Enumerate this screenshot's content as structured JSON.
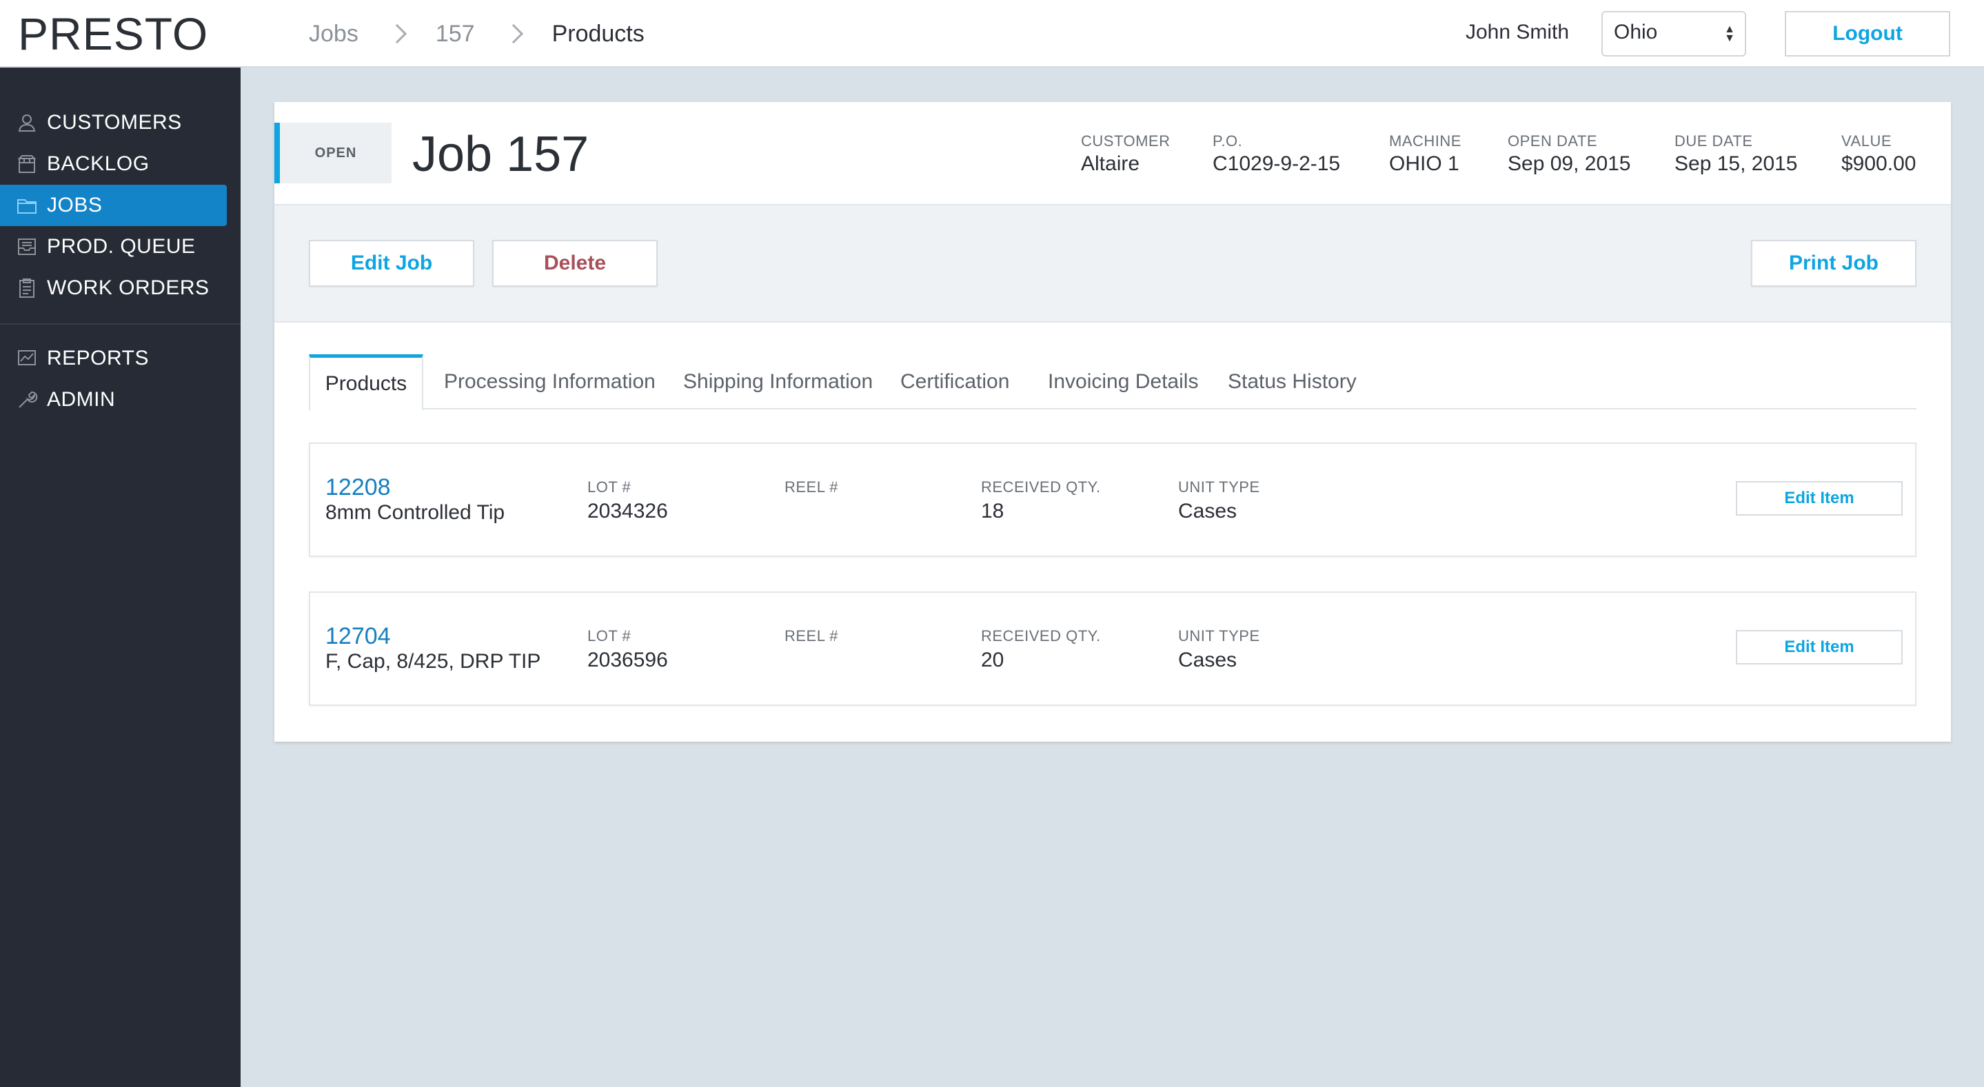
{
  "app": {
    "logo": "PRESTO"
  },
  "breadcrumb": [
    "Jobs",
    "157",
    "Products"
  ],
  "user": {
    "name": "John Smith"
  },
  "region": {
    "selected": "Ohio"
  },
  "logout_label": "Logout",
  "sidebar": {
    "items": [
      {
        "label": "CUSTOMERS",
        "icon": "user-icon"
      },
      {
        "label": "BACKLOG",
        "icon": "box-icon"
      },
      {
        "label": "JOBS",
        "icon": "folder-icon",
        "active": true
      },
      {
        "label": "PROD. QUEUE",
        "icon": "inbox-icon"
      },
      {
        "label": "WORK ORDERS",
        "icon": "clipboard-icon"
      },
      {
        "label": "REPORTS",
        "icon": "chart-icon"
      },
      {
        "label": "ADMIN",
        "icon": "wrench-icon"
      }
    ]
  },
  "job": {
    "status": "OPEN",
    "title": "Job 157",
    "meta": [
      {
        "label": "CUSTOMER",
        "value": "Altaire"
      },
      {
        "label": "P.O.",
        "value": "C1029-9-2-15"
      },
      {
        "label": "MACHINE",
        "value": "OHIO 1"
      },
      {
        "label": "OPEN DATE",
        "value": "Sep 09, 2015"
      },
      {
        "label": "DUE DATE",
        "value": "Sep 15, 2015"
      },
      {
        "label": "VALUE",
        "value": "$900.00"
      }
    ]
  },
  "actions": {
    "edit": "Edit Job",
    "delete": "Delete",
    "print": "Print Job"
  },
  "tabs": [
    "Products",
    "Processing Information",
    "Shipping Information",
    "Certification",
    "Invoicing Details",
    "Status History"
  ],
  "products": [
    {
      "id": "12208",
      "name": "8mm Controlled Tip",
      "lot_label": "LOT #",
      "lot": "2034326",
      "reel_label": "REEL #",
      "reel": "",
      "qty_label": "RECEIVED QTY.",
      "qty": "18",
      "unit_label": "UNIT TYPE",
      "unit": "Cases",
      "edit_label": "Edit Item"
    },
    {
      "id": "12704",
      "name": "F, Cap, 8/425, DRP TIP",
      "lot_label": "LOT #",
      "lot": "2036596",
      "reel_label": "REEL #",
      "reel": "",
      "qty_label": "RECEIVED QTY.",
      "qty": "20",
      "unit_label": "UNIT TYPE",
      "unit": "Cases",
      "edit_label": "Edit Item"
    }
  ],
  "colors": {
    "accent": "#0ea5e0",
    "sidebar_bg": "#262b35",
    "active_nav": "#1384c8",
    "danger": "#a8505a",
    "link": "#157fc0"
  }
}
